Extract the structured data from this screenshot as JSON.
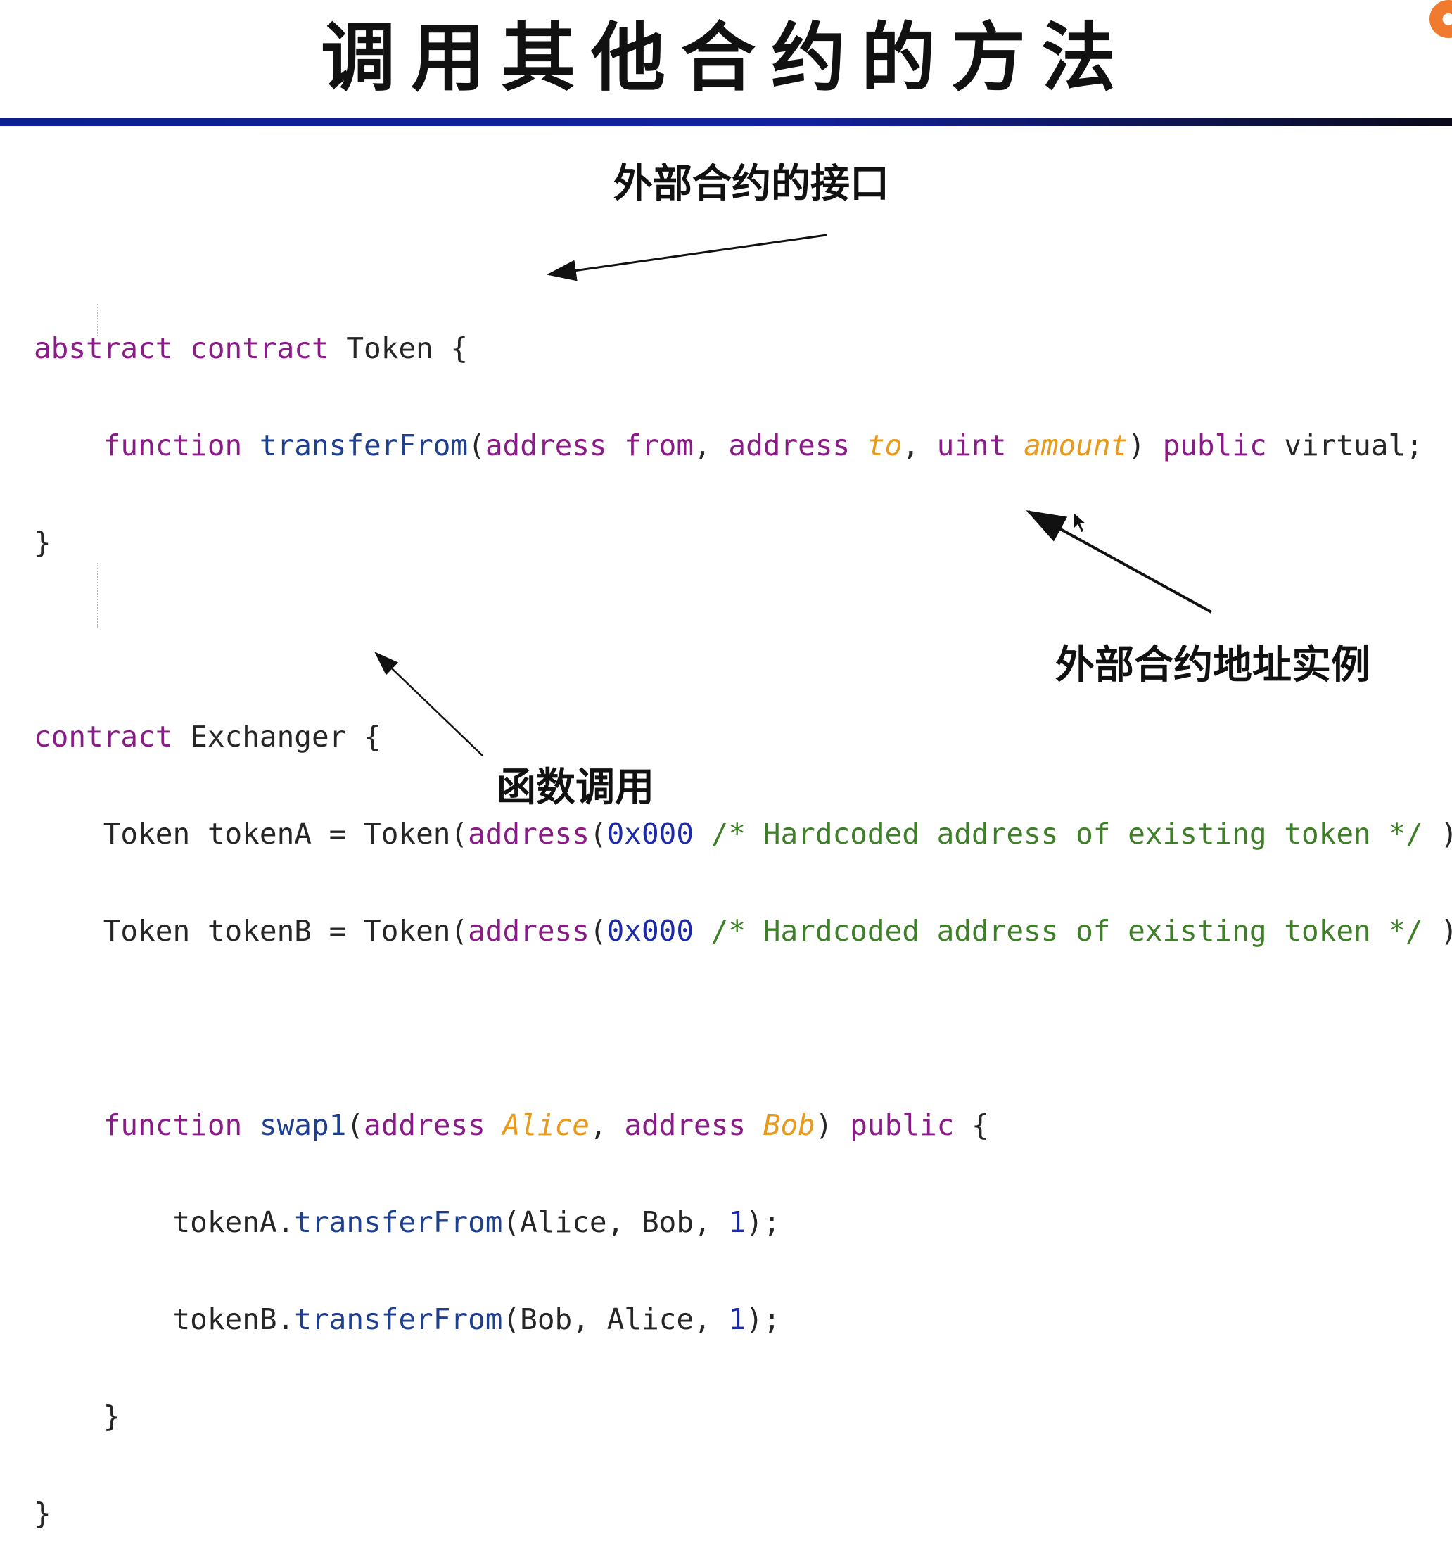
{
  "slide": {
    "title": "调用其他合约的方法"
  },
  "annotations": {
    "interface": "外部合约的接口",
    "instance": "外部合约地址实例",
    "call": "函数调用"
  },
  "code": {
    "l1": {
      "kw": "abstract contract",
      "name": " Token {"
    },
    "l2": {
      "kw": "function",
      "fn": "transferFrom",
      "p1": "(",
      "kw_addr1": "address from",
      "comma1": ", ",
      "kw_addr2": "address ",
      "to": "to",
      "comma2": ", ",
      "kw_uint": "uint ",
      "amount": "amount",
      "close": ") ",
      "kw_pub": "public",
      "rest": " virtual;"
    },
    "l3": "}",
    "l5": {
      "kw": "contract",
      "name": " Exchanger {"
    },
    "l6": {
      "lead": "Token tokenA = Token(",
      "kw_addr": "address",
      "paren": "(",
      "num": "0x000",
      "cmt": " /* Hardcoded address of existing token */",
      "end": " ));"
    },
    "l7": {
      "lead": "Token tokenB = Token(",
      "kw_addr": "address",
      "paren": "(",
      "num": "0x000",
      "cmt": " /* Hardcoded address of existing token */",
      "end": " ));"
    },
    "l9": {
      "kw": "function",
      "fn": "swap1",
      "p1": "(",
      "kw_addr1": "address ",
      "alice": "Alice",
      "comma": ", ",
      "kw_addr2": "address ",
      "bob": "Bob",
      "close": ") ",
      "kw_pub": "public",
      "brace": " {"
    },
    "l10": {
      "obj": "tokenA.",
      "fn": "transferFrom",
      "args": "(Alice, Bob, ",
      "num": "1",
      "end": ");"
    },
    "l11": {
      "obj": "tokenB.",
      "fn": "transferFrom",
      "args": "(Bob, Alice, ",
      "num": "1",
      "end": ");"
    },
    "l12": "}",
    "l13": "}"
  },
  "icons": {
    "cursor": "mouse-pointer-icon",
    "badge": "recording-badge-icon"
  },
  "colors": {
    "rule_start": "#0b1f8f",
    "rule_end": "#0a0a1a",
    "keyword": "#8a1c87",
    "function_name": "#1f3f8f",
    "param_italic": "#e89a1e",
    "number": "#1c2aa8",
    "comment": "#3f7f2a"
  }
}
